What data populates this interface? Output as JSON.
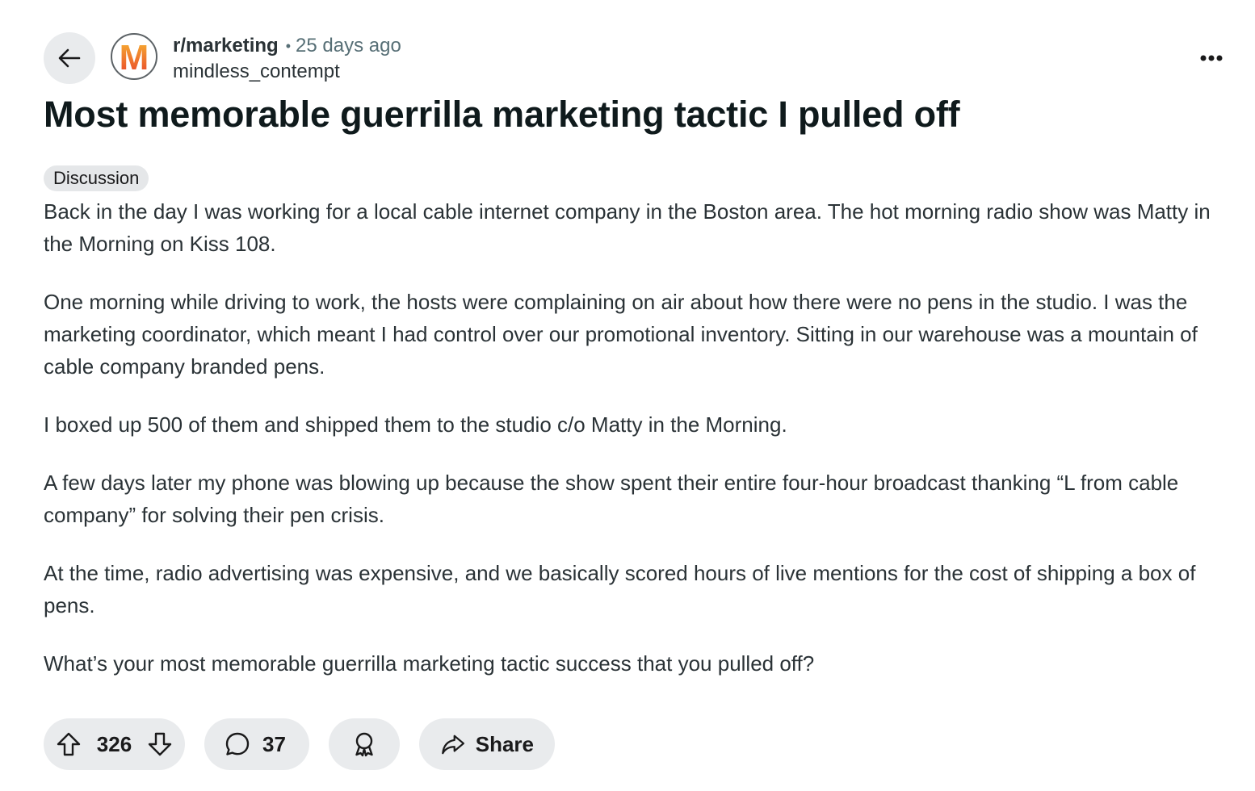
{
  "header": {
    "subreddit": "r/marketing",
    "separator": "•",
    "time_ago": "25 days ago",
    "username": "mindless_contempt",
    "avatar_letter": "M"
  },
  "post": {
    "title": "Most memorable guerrilla marketing tactic I pulled off",
    "flair": "Discussion",
    "paragraphs": [
      "Back in the day I was working for a local cable internet company in the Boston area. The hot morning radio show was Matty in the Morning on Kiss 108.",
      "One morning while driving to work, the hosts were complaining on air about how there were no pens in the studio. I was the marketing coordinator, which meant I had control over our promotional inventory. Sitting in our warehouse was a mountain of cable company branded pens.",
      "I boxed up 500 of them and shipped them to the studio c/o Matty in the Morning.",
      "A few days later my phone was blowing up because the show spent their entire four-hour broadcast thanking “L from cable company” for solving their pen crisis.",
      "At the time, radio advertising was expensive, and we basically scored hours of live mentions for the cost of shipping a box of pens.",
      "What’s your most memorable guerrilla marketing tactic success that you pulled off?"
    ]
  },
  "actions": {
    "vote_count": "326",
    "comment_count": "37",
    "share_label": "Share"
  },
  "icons": {
    "back": "arrow-left-icon",
    "more": "more-horizontal-icon",
    "upvote": "upvote-arrow-icon",
    "downvote": "downvote-arrow-icon",
    "comment": "comment-bubble-icon",
    "award": "award-icon",
    "share": "share-arrow-icon"
  },
  "colors": {
    "pill_background": "#e9ebed",
    "text_secondary": "#576f76",
    "avatar_gradient_top": "#f7b733",
    "avatar_gradient_bottom": "#e8402a"
  }
}
